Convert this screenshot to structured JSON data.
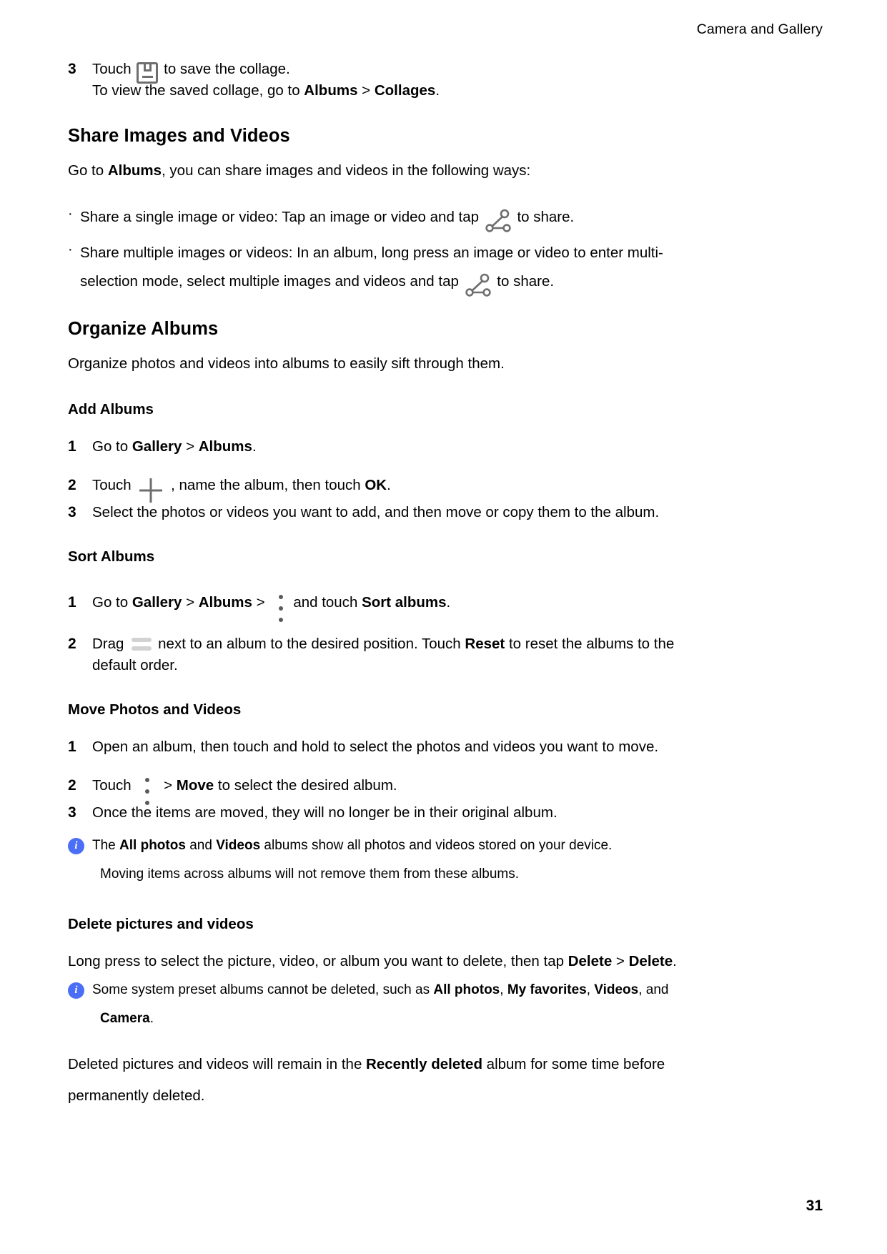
{
  "header": {
    "chapter_title": "Camera and Gallery"
  },
  "footer": {
    "page_number": "31"
  },
  "icons": {
    "save": "save-icon",
    "share": "share-icon",
    "plus": "plus-icon",
    "kebab": "more-options-icon",
    "drag": "drag-handle-icon",
    "info": "info-icon",
    "info_glyph": "i"
  },
  "colors": {
    "info_badge": "#4a6ef5",
    "icon_gray": "#6e6e6e",
    "drag_gray": "#d2d2d2",
    "text": "#000000"
  },
  "collage_step": {
    "number": "3",
    "text_before_icon": "Touch",
    "text_after_icon": "to save the collage.",
    "line2_a": "To view the saved collage, go to ",
    "line2_b1": "Albums",
    "line2_sep": " > ",
    "line2_b2": "Collages",
    "line2_end": "."
  },
  "share_section": {
    "heading": "Share Images and Videos",
    "intro_a": "Go to ",
    "intro_b": "Albums",
    "intro_c": ", you can share images and videos in the following ways:",
    "bullet_marker": "·",
    "bullet1_before": "Share a single image or video: Tap an image or video and tap",
    "bullet1_after": "to share.",
    "bullet2_line1": "Share multiple images or videos: In an album, long press an image or video to enter multi-",
    "bullet2_line2_before": "selection mode, select multiple images and videos and tap",
    "bullet2_line2_after": "to share."
  },
  "organize_section": {
    "heading": "Organize Albums",
    "intro": "Organize photos and videos into albums to easily sift through them."
  },
  "add_albums": {
    "heading": "Add Albums",
    "steps": [
      {
        "number": "1",
        "a": "Go to ",
        "b1": "Gallery",
        "sep": " > ",
        "b2": "Albums",
        "end": "."
      },
      {
        "number": "2",
        "before_icon": "Touch",
        "after_icon": ", name the album, then touch ",
        "bold": "OK",
        "end": "."
      },
      {
        "number": "3",
        "text": "Select the photos or videos you want to add, and then move or copy them to the album."
      }
    ]
  },
  "sort_albums": {
    "heading": "Sort Albums",
    "step1": {
      "number": "1",
      "a": "Go to ",
      "b1": "Gallery",
      "sep1": " > ",
      "b2": "Albums",
      "sep2": " > ",
      "after_icon": "and touch ",
      "b3": "Sort albums",
      "end": "."
    },
    "step2": {
      "number": "2",
      "before_icon": "Drag",
      "after_icon": "next to an album to the desired position. Touch ",
      "bold": "Reset",
      "after_bold": " to reset the albums to the",
      "line2": "default order."
    }
  },
  "move_photos": {
    "heading": "Move Photos and Videos",
    "step1": {
      "number": "1",
      "text": "Open an album, then touch and hold to select the photos and videos you want to move."
    },
    "step2": {
      "number": "2",
      "before_icon": "Touch",
      "after_icon": " > ",
      "bold": "Move",
      "end": " to select the desired album."
    },
    "step3": {
      "number": "3",
      "text": "Once the items are moved, they will no longer be in their original album."
    },
    "note": {
      "a": "The ",
      "b1": "All photos",
      "mid": " and ",
      "b2": "Videos",
      "c": " albums show all photos and videos stored on your device.",
      "line2": "Moving items across albums will not remove them from these albums."
    }
  },
  "delete_section": {
    "heading": "Delete pictures and videos",
    "para_a": "Long press to select the picture, video, or album you want to delete, then tap ",
    "para_b1": "Delete",
    "para_sep": " > ",
    "para_b2": "Delete",
    "para_end": ".",
    "note": {
      "a": "Some system preset albums cannot be deleted, such as ",
      "b1": "All photos",
      "sep1": ", ",
      "b2": "My favorites",
      "sep2": ", ",
      "b3": "Videos",
      "sep3": ", and",
      "line2_b": "Camera",
      "line2_end": "."
    },
    "closing_line1": "Deleted pictures and videos will remain in the ",
    "closing_bold": "Recently deleted",
    "closing_line1_end": " album for some time before",
    "closing_line2": "permanently deleted."
  }
}
